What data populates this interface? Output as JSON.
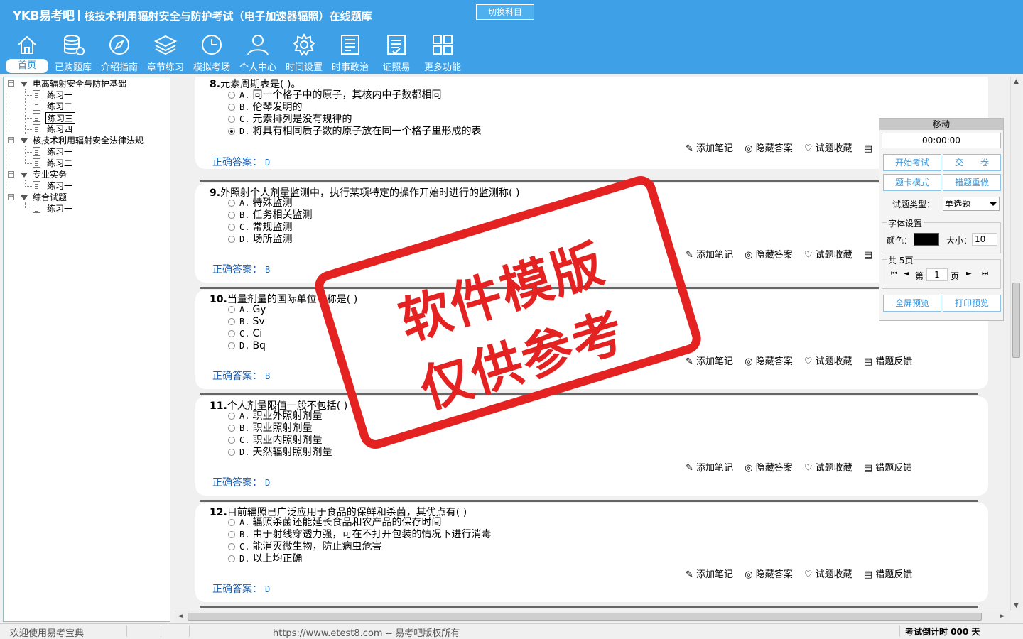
{
  "header": {
    "logo": "YKB易考吧",
    "title": "核技术利用辐射安全与防护考试（电子加速器辐照）在线题库",
    "switch_label": "切换科目",
    "nav": [
      {
        "label": "首页",
        "icon": "home-icon"
      },
      {
        "label": "已购题库",
        "icon": "database-icon"
      },
      {
        "label": "介绍指南",
        "icon": "compass-icon"
      },
      {
        "label": "章节练习",
        "icon": "layers-icon"
      },
      {
        "label": "模拟考场",
        "icon": "clock-icon"
      },
      {
        "label": "个人中心",
        "icon": "user-icon"
      },
      {
        "label": "时间设置",
        "icon": "gear-icon"
      },
      {
        "label": "时事政治",
        "icon": "news-icon"
      },
      {
        "label": "证照易",
        "icon": "certificate-icon"
      },
      {
        "label": "更多功能",
        "icon": "grid-icon"
      }
    ]
  },
  "tree": [
    {
      "label": "电离辐射安全与防护基础",
      "children": [
        "练习一",
        "练习二",
        "练习三",
        "练习四"
      ],
      "selected_child": 2
    },
    {
      "label": "核技术利用辐射安全法律法规",
      "children": [
        "练习一",
        "练习二"
      ]
    },
    {
      "label": "专业实务",
      "children": [
        "练习一"
      ]
    },
    {
      "label": "综合试题",
      "children": [
        "练习一"
      ]
    }
  ],
  "questions": [
    {
      "num": "8.",
      "text": "元素周期表是( )。",
      "options": [
        {
          "letter": "A.",
          "text": "同一个格子中的原子，其核内中子数都相同"
        },
        {
          "letter": "B.",
          "text": "伦琴发明的"
        },
        {
          "letter": "C.",
          "text": "元素排列是没有规律的"
        },
        {
          "letter": "D.",
          "text": "将具有相同质子数的原子放在同一个格子里形成的表"
        }
      ],
      "selected": 3,
      "answer": "D"
    },
    {
      "num": "9.",
      "text": "外照射个人剂量监测中，执行某项特定的操作开始时进行的监测称( )",
      "options": [
        {
          "letter": "A.",
          "text": "特殊监测"
        },
        {
          "letter": "B.",
          "text": "任务相关监测"
        },
        {
          "letter": "C.",
          "text": "常规监测"
        },
        {
          "letter": "D.",
          "text": "场所监测"
        }
      ],
      "selected": -1,
      "answer": "B"
    },
    {
      "num": "10.",
      "text": "当量剂量的国际单位专称是( )",
      "options": [
        {
          "letter": "A.",
          "text": "Gy"
        },
        {
          "letter": "B.",
          "text": "Sv"
        },
        {
          "letter": "C.",
          "text": "Ci"
        },
        {
          "letter": "D.",
          "text": "Bq"
        }
      ],
      "selected": -1,
      "answer": "B"
    },
    {
      "num": "11.",
      "text": "个人剂量限值一般不包括( )",
      "options": [
        {
          "letter": "A.",
          "text": "职业外照射剂量"
        },
        {
          "letter": "B.",
          "text": "职业照射剂量"
        },
        {
          "letter": "C.",
          "text": "职业内照射剂量"
        },
        {
          "letter": "D.",
          "text": "天然辐射照射剂量"
        }
      ],
      "selected": -1,
      "answer": "D"
    },
    {
      "num": "12.",
      "text": "目前辐照已广泛应用于食品的保鲜和杀菌，其优点有( )",
      "options": [
        {
          "letter": "A.",
          "text": "辐照杀菌还能延长食品和农产品的保存时间"
        },
        {
          "letter": "B.",
          "text": "由于射线穿透力强，可在不打开包装的情况下进行消毒"
        },
        {
          "letter": "C.",
          "text": "能消灭微生物，防止病虫危害"
        },
        {
          "letter": "D.",
          "text": "以上均正确"
        }
      ],
      "selected": -1,
      "answer": "D"
    }
  ],
  "actions": {
    "add_note": "添加笔记",
    "hide_answer": "隐藏答案",
    "favorite": "试题收藏",
    "feedback": "错题反馈",
    "answer_label": "正确答案："
  },
  "panel": {
    "title": "移动",
    "timer": "00:00:00",
    "start_exam": "开始考试",
    "submit": "交　　卷",
    "card_mode": "题卡模式",
    "redo_wrong": "错题重做",
    "type_label": "试题类型：",
    "type_value": "单选题",
    "font_group": "字体设置",
    "color_label": "颜色：",
    "size_label": "大小：",
    "size_value": "10",
    "pages_group": "共 5页",
    "page_prefix": "第",
    "page_value": "1",
    "page_suffix": "页",
    "fullscreen": "全屏预览",
    "print": "打印预览"
  },
  "status": {
    "welcome": "欢迎使用易考宝典",
    "copyright": "https://www.etest8.com -- 易考吧版权所有",
    "countdown": "考试倒计时 000 天"
  },
  "watermark": {
    "line1": "软件模版",
    "line2": "仅供参考"
  },
  "colors": {
    "header_bg": "#3ea1e7",
    "accent": "#3a97dc",
    "watermark": "#e52222"
  }
}
